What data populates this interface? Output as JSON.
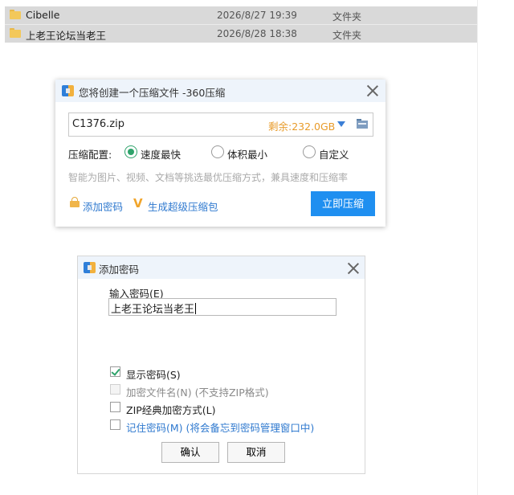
{
  "files": [
    {
      "name": "Cibelle",
      "date": "2026/8/27 19:39",
      "type": "文件夹"
    },
    {
      "name": "上老王论坛当老王",
      "date": "2026/8/28 18:38",
      "type": "文件夹"
    }
  ],
  "compress_dialog": {
    "title": "您将创建一个压缩文件 -360压缩",
    "filename": "C1376.zip",
    "free_space": "剩余:232.0GB",
    "config_label": "压缩配置:",
    "options": [
      {
        "label": "速度最快",
        "selected": true
      },
      {
        "label": "体积最小",
        "selected": false
      },
      {
        "label": "自定义",
        "selected": false
      }
    ],
    "hint": "智能为图片、视频、文档等挑选最优压缩方式，兼具速度和压缩率",
    "add_password_link": "添加密码",
    "super_pack_link": "生成超级压缩包",
    "compress_button": "立即压缩",
    "accent_color": "#1f8ff0"
  },
  "password_dialog": {
    "title": "添加密码",
    "input_label": "输入密码(E)",
    "password_value": "上老王论坛当老王",
    "checkboxes": [
      {
        "label": "显示密码(S)",
        "checked": true,
        "disabled": false
      },
      {
        "label": "加密文件名(N) (不支持ZIP格式)",
        "checked": false,
        "disabled": true
      },
      {
        "label": "ZIP经典加密方式(L)",
        "checked": false,
        "disabled": false
      },
      {
        "label": "记住密码(M) (将会备忘到密码管理窗口中)",
        "checked": false,
        "disabled": false
      }
    ],
    "ok_button": "确认",
    "cancel_button": "取消"
  }
}
